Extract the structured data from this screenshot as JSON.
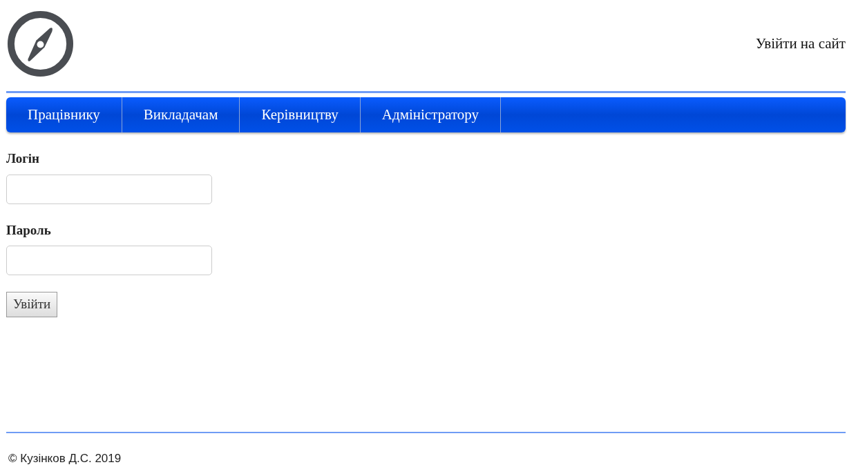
{
  "header": {
    "login_link": "Увійти на сайт"
  },
  "nav": [
    {
      "label": "Працівнику"
    },
    {
      "label": "Викладачам"
    },
    {
      "label": "Керівництву"
    },
    {
      "label": "Адміністратору"
    }
  ],
  "form": {
    "fields": [
      {
        "label": "Логін"
      },
      {
        "label": "Пароль"
      }
    ],
    "submit": "Увійти"
  },
  "footer": {
    "text": "© Кузінков Д.С. 2019"
  }
}
